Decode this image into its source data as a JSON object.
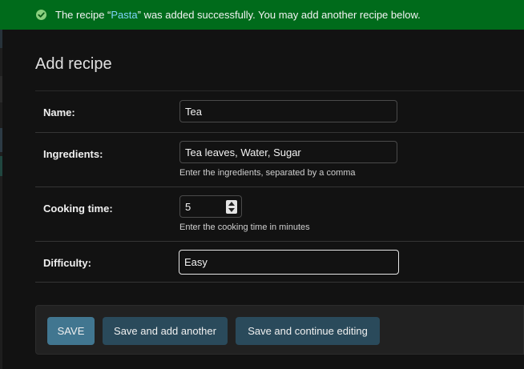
{
  "message": {
    "prefix": "The recipe “",
    "link": "Pasta",
    "suffix": "” was added successfully. You may add another recipe below.",
    "icon": "check-circle-icon",
    "color": "#006b1b"
  },
  "page": {
    "title": "Add recipe"
  },
  "form": {
    "name": {
      "label": "Name:",
      "value": "Tea"
    },
    "ingredients": {
      "label": "Ingredients:",
      "value": "Tea leaves, Water, Sugar",
      "help": "Enter the ingredients, separated by a comma"
    },
    "cooking_time": {
      "label": "Cooking time:",
      "value": "5",
      "help": "Enter the cooking time in minutes"
    },
    "difficulty": {
      "label": "Difficulty:",
      "value": "Easy"
    }
  },
  "buttons": {
    "save": "SAVE",
    "save_add_another": "Save and add another",
    "save_continue": "Save and continue editing"
  },
  "colors": {
    "primary_button": "#417690",
    "secondary_button": "#2a4a5b",
    "link": "#81d4fa"
  }
}
